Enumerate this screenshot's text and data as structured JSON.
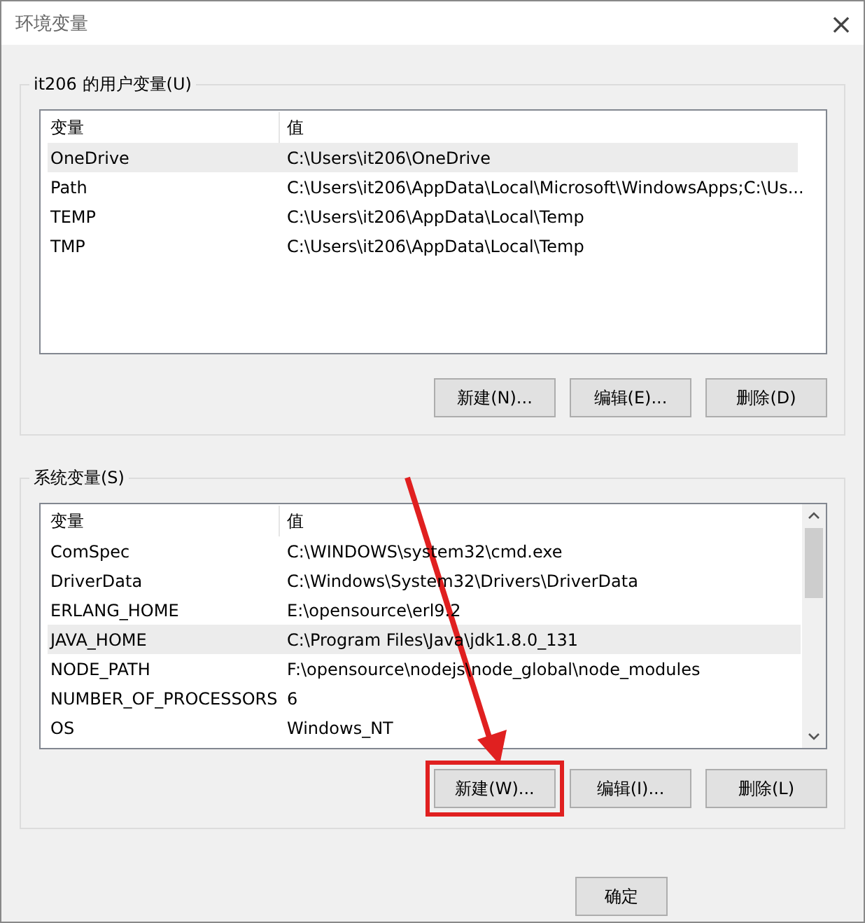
{
  "window": {
    "title": "环境变量",
    "close": "×"
  },
  "user_vars": {
    "label": "it206 的用户变量(U)",
    "columns": [
      "变量",
      "值"
    ],
    "rows": [
      {
        "name": "OneDrive",
        "value": "C:\\Users\\it206\\OneDrive",
        "selected": true
      },
      {
        "name": "Path",
        "value": "C:\\Users\\it206\\AppData\\Local\\Microsoft\\WindowsApps;C:\\Us...",
        "selected": false
      },
      {
        "name": "TEMP",
        "value": "C:\\Users\\it206\\AppData\\Local\\Temp",
        "selected": false
      },
      {
        "name": "TMP",
        "value": "C:\\Users\\it206\\AppData\\Local\\Temp",
        "selected": false
      }
    ],
    "scrollbar": false,
    "buttons": [
      {
        "label": "新建(N)...",
        "highlighted": false
      },
      {
        "label": "编辑(E)...",
        "highlighted": false
      },
      {
        "label": "删除(D)",
        "highlighted": false
      }
    ]
  },
  "system_vars": {
    "label": "系统变量(S)",
    "columns": [
      "变量",
      "值"
    ],
    "rows": [
      {
        "name": "ComSpec",
        "value": "C:\\WINDOWS\\system32\\cmd.exe",
        "selected": false
      },
      {
        "name": "DriverData",
        "value": "C:\\Windows\\System32\\Drivers\\DriverData",
        "selected": false
      },
      {
        "name": "ERLANG_HOME",
        "value": "E:\\opensource\\erl9.2",
        "selected": false
      },
      {
        "name": "JAVA_HOME",
        "value": "C:\\Program Files\\Java\\jdk1.8.0_131",
        "selected": true
      },
      {
        "name": "NODE_PATH",
        "value": "F:\\opensource\\nodejs\\node_global\\node_modules",
        "selected": false
      },
      {
        "name": "NUMBER_OF_PROCESSORS",
        "value": "6",
        "selected": false
      },
      {
        "name": "OS",
        "value": "Windows_NT",
        "selected": false
      }
    ],
    "scrollbar": true,
    "buttons": [
      {
        "label": "新建(W)...",
        "highlighted": true
      },
      {
        "label": "编辑(I)...",
        "highlighted": false
      },
      {
        "label": "删除(L)",
        "highlighted": false
      }
    ]
  },
  "footer_buttons": [
    "确定"
  ]
}
